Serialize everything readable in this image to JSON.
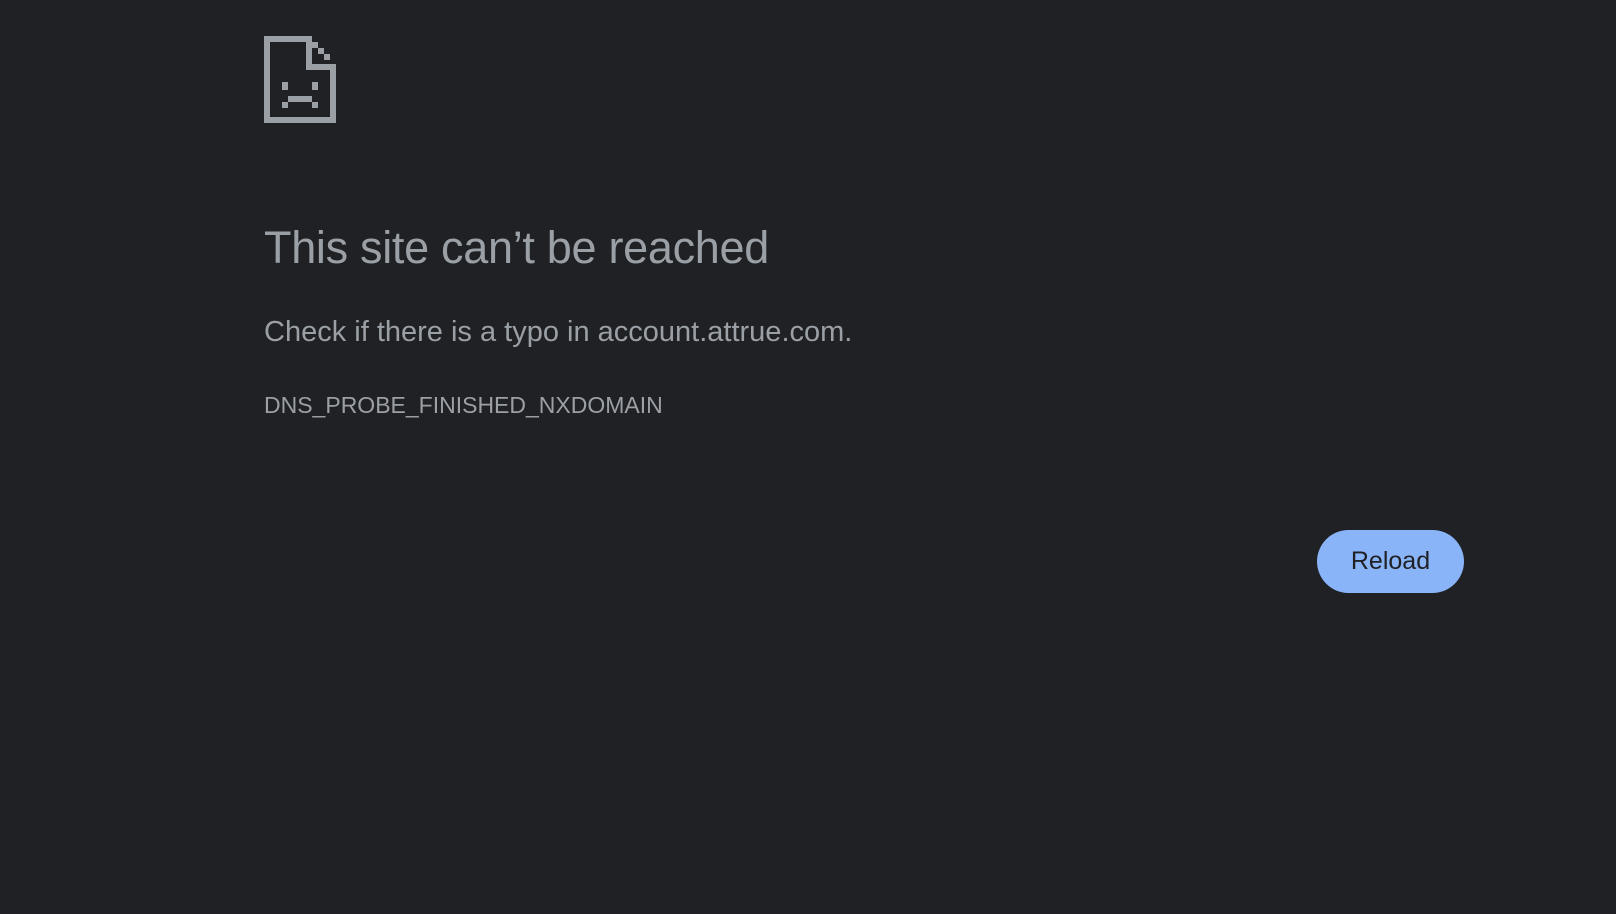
{
  "error_page": {
    "icon": "sad-document-icon",
    "title": "This site can’t be reached",
    "summary": "Check if there is a typo in account.attrue.com.",
    "error_code": "DNS_PROBE_FINISHED_NXDOMAIN",
    "reload_label": "Reload"
  },
  "colors": {
    "background": "#202124",
    "text": "#9aa0a6",
    "icon": "#9aa0a6",
    "button_background": "#8ab4f8",
    "button_text": "#202124"
  }
}
